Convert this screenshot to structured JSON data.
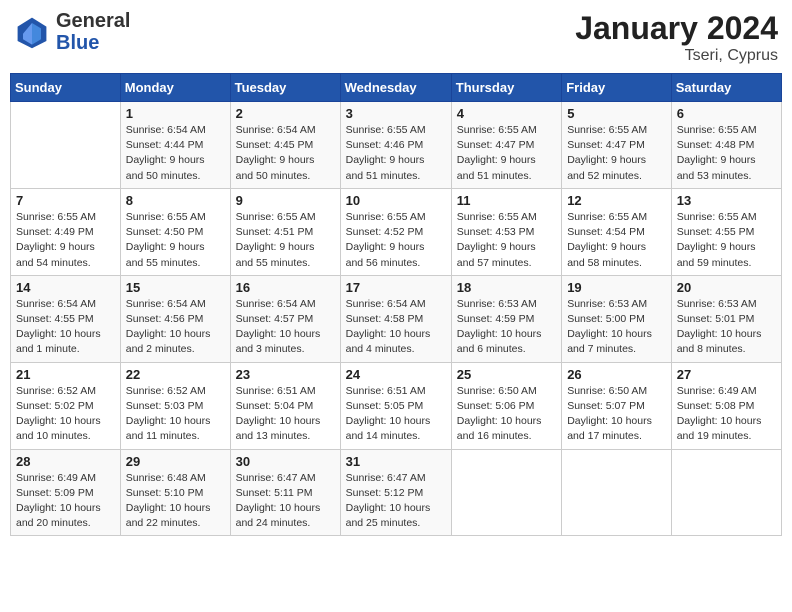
{
  "header": {
    "logo_general": "General",
    "logo_blue": "Blue",
    "month": "January 2024",
    "location": "Tseri, Cyprus"
  },
  "weekdays": [
    "Sunday",
    "Monday",
    "Tuesday",
    "Wednesday",
    "Thursday",
    "Friday",
    "Saturday"
  ],
  "weeks": [
    [
      {
        "day": "",
        "info": ""
      },
      {
        "day": "1",
        "info": "Sunrise: 6:54 AM\nSunset: 4:44 PM\nDaylight: 9 hours\nand 50 minutes."
      },
      {
        "day": "2",
        "info": "Sunrise: 6:54 AM\nSunset: 4:45 PM\nDaylight: 9 hours\nand 50 minutes."
      },
      {
        "day": "3",
        "info": "Sunrise: 6:55 AM\nSunset: 4:46 PM\nDaylight: 9 hours\nand 51 minutes."
      },
      {
        "day": "4",
        "info": "Sunrise: 6:55 AM\nSunset: 4:47 PM\nDaylight: 9 hours\nand 51 minutes."
      },
      {
        "day": "5",
        "info": "Sunrise: 6:55 AM\nSunset: 4:47 PM\nDaylight: 9 hours\nand 52 minutes."
      },
      {
        "day": "6",
        "info": "Sunrise: 6:55 AM\nSunset: 4:48 PM\nDaylight: 9 hours\nand 53 minutes."
      }
    ],
    [
      {
        "day": "7",
        "info": "Sunrise: 6:55 AM\nSunset: 4:49 PM\nDaylight: 9 hours\nand 54 minutes."
      },
      {
        "day": "8",
        "info": "Sunrise: 6:55 AM\nSunset: 4:50 PM\nDaylight: 9 hours\nand 55 minutes."
      },
      {
        "day": "9",
        "info": "Sunrise: 6:55 AM\nSunset: 4:51 PM\nDaylight: 9 hours\nand 55 minutes."
      },
      {
        "day": "10",
        "info": "Sunrise: 6:55 AM\nSunset: 4:52 PM\nDaylight: 9 hours\nand 56 minutes."
      },
      {
        "day": "11",
        "info": "Sunrise: 6:55 AM\nSunset: 4:53 PM\nDaylight: 9 hours\nand 57 minutes."
      },
      {
        "day": "12",
        "info": "Sunrise: 6:55 AM\nSunset: 4:54 PM\nDaylight: 9 hours\nand 58 minutes."
      },
      {
        "day": "13",
        "info": "Sunrise: 6:55 AM\nSunset: 4:55 PM\nDaylight: 9 hours\nand 59 minutes."
      }
    ],
    [
      {
        "day": "14",
        "info": "Sunrise: 6:54 AM\nSunset: 4:55 PM\nDaylight: 10 hours\nand 1 minute."
      },
      {
        "day": "15",
        "info": "Sunrise: 6:54 AM\nSunset: 4:56 PM\nDaylight: 10 hours\nand 2 minutes."
      },
      {
        "day": "16",
        "info": "Sunrise: 6:54 AM\nSunset: 4:57 PM\nDaylight: 10 hours\nand 3 minutes."
      },
      {
        "day": "17",
        "info": "Sunrise: 6:54 AM\nSunset: 4:58 PM\nDaylight: 10 hours\nand 4 minutes."
      },
      {
        "day": "18",
        "info": "Sunrise: 6:53 AM\nSunset: 4:59 PM\nDaylight: 10 hours\nand 6 minutes."
      },
      {
        "day": "19",
        "info": "Sunrise: 6:53 AM\nSunset: 5:00 PM\nDaylight: 10 hours\nand 7 minutes."
      },
      {
        "day": "20",
        "info": "Sunrise: 6:53 AM\nSunset: 5:01 PM\nDaylight: 10 hours\nand 8 minutes."
      }
    ],
    [
      {
        "day": "21",
        "info": "Sunrise: 6:52 AM\nSunset: 5:02 PM\nDaylight: 10 hours\nand 10 minutes."
      },
      {
        "day": "22",
        "info": "Sunrise: 6:52 AM\nSunset: 5:03 PM\nDaylight: 10 hours\nand 11 minutes."
      },
      {
        "day": "23",
        "info": "Sunrise: 6:51 AM\nSunset: 5:04 PM\nDaylight: 10 hours\nand 13 minutes."
      },
      {
        "day": "24",
        "info": "Sunrise: 6:51 AM\nSunset: 5:05 PM\nDaylight: 10 hours\nand 14 minutes."
      },
      {
        "day": "25",
        "info": "Sunrise: 6:50 AM\nSunset: 5:06 PM\nDaylight: 10 hours\nand 16 minutes."
      },
      {
        "day": "26",
        "info": "Sunrise: 6:50 AM\nSunset: 5:07 PM\nDaylight: 10 hours\nand 17 minutes."
      },
      {
        "day": "27",
        "info": "Sunrise: 6:49 AM\nSunset: 5:08 PM\nDaylight: 10 hours\nand 19 minutes."
      }
    ],
    [
      {
        "day": "28",
        "info": "Sunrise: 6:49 AM\nSunset: 5:09 PM\nDaylight: 10 hours\nand 20 minutes."
      },
      {
        "day": "29",
        "info": "Sunrise: 6:48 AM\nSunset: 5:10 PM\nDaylight: 10 hours\nand 22 minutes."
      },
      {
        "day": "30",
        "info": "Sunrise: 6:47 AM\nSunset: 5:11 PM\nDaylight: 10 hours\nand 24 minutes."
      },
      {
        "day": "31",
        "info": "Sunrise: 6:47 AM\nSunset: 5:12 PM\nDaylight: 10 hours\nand 25 minutes."
      },
      {
        "day": "",
        "info": ""
      },
      {
        "day": "",
        "info": ""
      },
      {
        "day": "",
        "info": ""
      }
    ]
  ]
}
